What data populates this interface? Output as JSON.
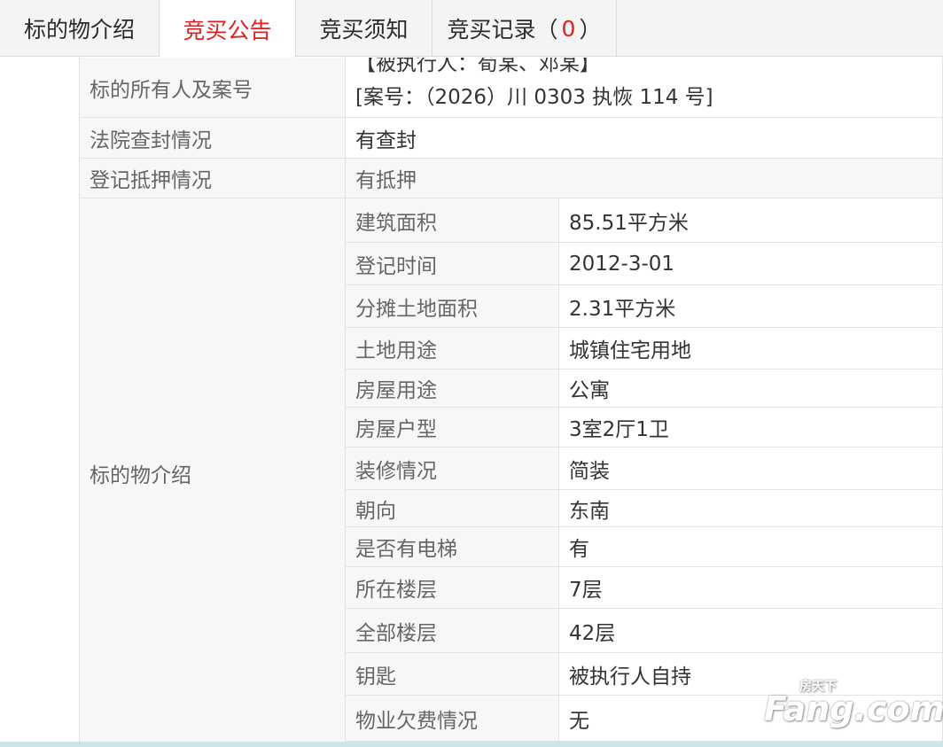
{
  "tabs": [
    {
      "label": "标的物介绍",
      "active": false
    },
    {
      "label": "竞买公告",
      "active": true
    },
    {
      "label": "竞买须知",
      "active": false
    },
    {
      "label": "竞买记录",
      "count": "0",
      "active": false
    }
  ],
  "tab_record_open": "（",
  "tab_record_close": "）",
  "table": {
    "owner_label": "标的所有人及案号",
    "owner_line1": "【被执行人：荀某、邓某】",
    "owner_line2": "[案号：（2026）川 0303 执恢 114 号]",
    "seal_label": "法院查封情况",
    "seal_value": "有查封",
    "mortgage_label": "登记抵押情况",
    "mortgage_value": "有抵押",
    "intro_label": "标的物介绍",
    "details": [
      {
        "label": "建筑面积",
        "value": "85.51平方米"
      },
      {
        "label": "登记时间",
        "value": "2012-3-01"
      },
      {
        "label": "分摊土地面积",
        "value": "2.31平方米"
      },
      {
        "label": "土地用途",
        "value": "城镇住宅用地"
      },
      {
        "label": "房屋用途",
        "value": "公寓"
      },
      {
        "label": "房屋户型",
        "value": "3室2厅1卫"
      },
      {
        "label": "装修情况",
        "value": "简装"
      },
      {
        "label": "朝向",
        "value": "东南"
      },
      {
        "label": "是否有电梯",
        "value": "有"
      },
      {
        "label": "所在楼层",
        "value": "7层"
      },
      {
        "label": "全部楼层",
        "value": "42层"
      },
      {
        "label": "钥匙",
        "value": "被执行人自持"
      },
      {
        "label": "物业欠费情况",
        "value": "无"
      }
    ]
  },
  "watermark": {
    "text_small": "房天下",
    "text_big": "Fang.com"
  },
  "colors": {
    "accent": "#e02020",
    "label_bg": "#f7f7f7",
    "border": "#e3e3e3"
  }
}
